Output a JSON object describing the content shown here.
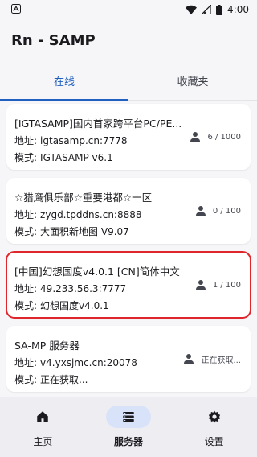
{
  "status_bar": {
    "left_icon": "a-letter-icon",
    "time": "4:00"
  },
  "app_title": "Rn - SAMP",
  "tabs": [
    {
      "label": "在线",
      "active": true
    },
    {
      "label": "收藏夹",
      "active": false
    }
  ],
  "servers": [
    {
      "title": "[IGTASAMP]国内首家跨平台PC/PE...",
      "address_label": "地址:",
      "address": "igtasamp.cn:7778",
      "mode_label": "模式:",
      "mode": "IGTASAMP v6.1",
      "players": "6 / 1000",
      "selected": false
    },
    {
      "title": "☆猎鹰俱乐部☆重要港都☆一区",
      "address_label": "地址:",
      "address": "zygd.tpddns.cn:8888",
      "mode_label": "模式:",
      "mode": "大面积新地图 V9.07",
      "players": "0 / 100",
      "selected": false
    },
    {
      "title": "[中国]幻想国度v4.0.1 [CN]简体中文",
      "address_label": "地址:",
      "address": "49.233.56.3:7777",
      "mode_label": "模式:",
      "mode": "幻想国度v4.0.1",
      "players": "1 / 100",
      "selected": true
    },
    {
      "title": "SA-MP 服务器",
      "address_label": "地址:",
      "address": "v4.yxsjmc.cn:20078",
      "mode_label": "模式:",
      "mode": "正在获取...",
      "players": "正在获取...",
      "selected": false
    }
  ],
  "bottom_nav": [
    {
      "label": "主页",
      "icon": "home-icon",
      "active": false
    },
    {
      "label": "服务器",
      "icon": "server-list-icon",
      "active": true
    },
    {
      "label": "设置",
      "icon": "gear-icon",
      "active": false
    }
  ],
  "colors": {
    "accent": "#1f5fbf",
    "selection_outline": "#e0262c",
    "nav_active_pill": "#d8e2f8"
  }
}
